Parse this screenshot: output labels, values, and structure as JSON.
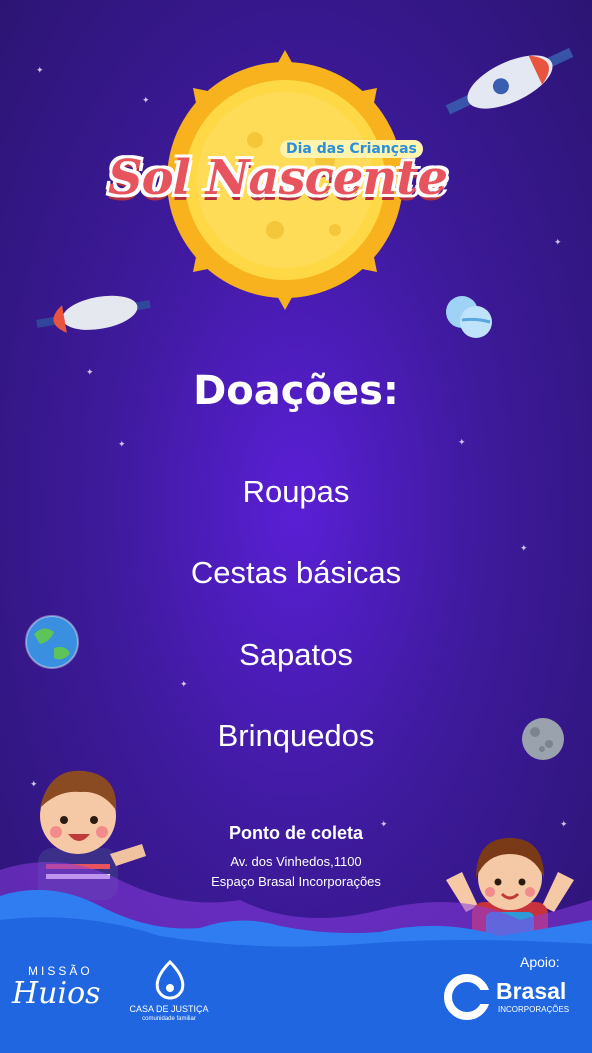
{
  "logo": {
    "subtitle": "Dia das Crianças",
    "title": "Sol Nascente"
  },
  "donations": {
    "heading": "Doações:",
    "items": [
      "Roupas",
      "Cestas básicas",
      "Sapatos",
      "Brinquedos"
    ]
  },
  "collection": {
    "title": "Ponto de coleta",
    "address": "Av. dos Vinhedos,1100",
    "place": "Espaço Brasal Incorporações"
  },
  "footer": {
    "missao_top": "MISSÃO",
    "missao_bottom": "Huios",
    "casa_name": "CASA DE JUSTIÇA",
    "casa_tagline": "comunidade familiar",
    "support_label": "Apoio:",
    "brasal_name": "Brasal",
    "brasal_sub": "INCORPORAÇÕES"
  },
  "colors": {
    "background": "#3e1a9c",
    "title_red": "#e8545e",
    "sun": "#f7c21e",
    "cloud_blue": "#2f7df0",
    "text": "#ffffff"
  }
}
